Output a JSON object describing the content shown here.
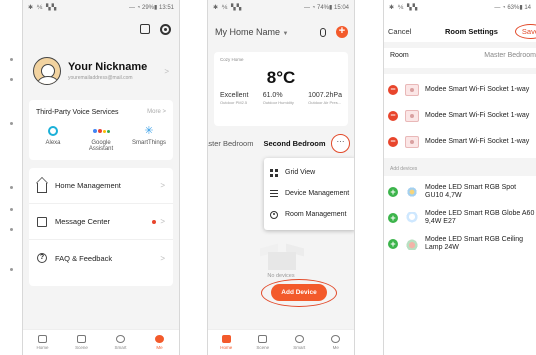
{
  "status": {
    "me_right": "— ◔ 29%▮ 13:51",
    "home_right": "— ◔ 74%▮ 15:04",
    "room_right": "— ◔ 63%▮ 14",
    "left_icons": "✱ ⅍ ▚▚"
  },
  "me": {
    "nickname": "Your Nickname",
    "email": "youremailaddress@mail.com",
    "voice_title": "Third-Party Voice Services",
    "voice_more": "More >",
    "voice_items": [
      "Alexa",
      "Google Assistant",
      "SmartThings"
    ],
    "menu": [
      "Home Management",
      "Message Center",
      "FAQ & Feedback"
    ],
    "tabs": [
      "Home",
      "Scene",
      "Smart",
      "Me"
    ]
  },
  "home": {
    "title": "My Home Name",
    "weather_location": "Cozy Home",
    "temperature": "8°C",
    "stats": [
      {
        "value": "Excellent",
        "label": "Outdoor PM2.5"
      },
      {
        "value": "61.0%",
        "label": "Outdoor Humidity"
      },
      {
        "value": "1007.2hPa",
        "label": "Outdoor Air Pres..."
      }
    ],
    "room_tabs": [
      "Master Bedroom",
      "Second Bedroom"
    ],
    "more_button": "···",
    "popup_items": [
      "Grid View",
      "Device Management",
      "Room Management"
    ],
    "no_devices": "No devices",
    "add_device": "Add Device",
    "tabs": [
      "Home",
      "Scene",
      "Smart",
      "Me"
    ]
  },
  "room": {
    "cancel": "Cancel",
    "title": "Room Settings",
    "save": "Save",
    "room_label": "Room",
    "room_value": "Master Bedroom",
    "added": [
      "Modee Smart Wi-Fi Socket 1-way",
      "Modee Smart Wi-Fi Socket 1-way",
      "Modee Smart Wi-Fi Socket 1-way"
    ],
    "add_devices_label": "Add devices",
    "available": [
      "Modee LED Smart RGB Spot GU10 4,7W",
      "Modee LED Smart RGB Globe A60 9,4W E27",
      "Modee LED Smart RGB Ceiling Lamp 24W"
    ]
  },
  "colors": {
    "accent": "#f35a2b",
    "highlight_ring": "#e24a2a",
    "remove": "#e8452c",
    "add": "#3cb44b"
  }
}
